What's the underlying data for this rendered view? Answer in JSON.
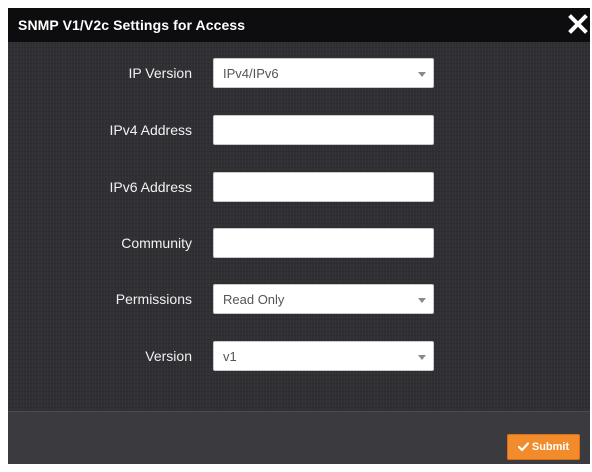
{
  "dialog": {
    "title": "SNMP V1/V2c Settings for Access",
    "close_icon": "close-icon",
    "colors": {
      "titlebar": "#0d0d0f",
      "body": "#2f2f34",
      "footer": "#3b3b3f",
      "accent": "#f28b2c"
    }
  },
  "form": {
    "ip_version": {
      "label": "IP Version",
      "value": "IPv4/IPv6",
      "icon": "chevron-down-icon"
    },
    "ipv4_address": {
      "label": "IPv4 Address",
      "value": "",
      "placeholder": ""
    },
    "ipv6_address": {
      "label": "IPv6 Address",
      "value": "",
      "placeholder": ""
    },
    "community": {
      "label": "Community",
      "value": "",
      "placeholder": ""
    },
    "permissions": {
      "label": "Permissions",
      "value": "Read Only",
      "icon": "chevron-down-icon"
    },
    "version": {
      "label": "Version",
      "value": "v1",
      "icon": "chevron-down-icon"
    }
  },
  "footer": {
    "submit_label": "Submit",
    "submit_icon": "checkmark-icon"
  }
}
